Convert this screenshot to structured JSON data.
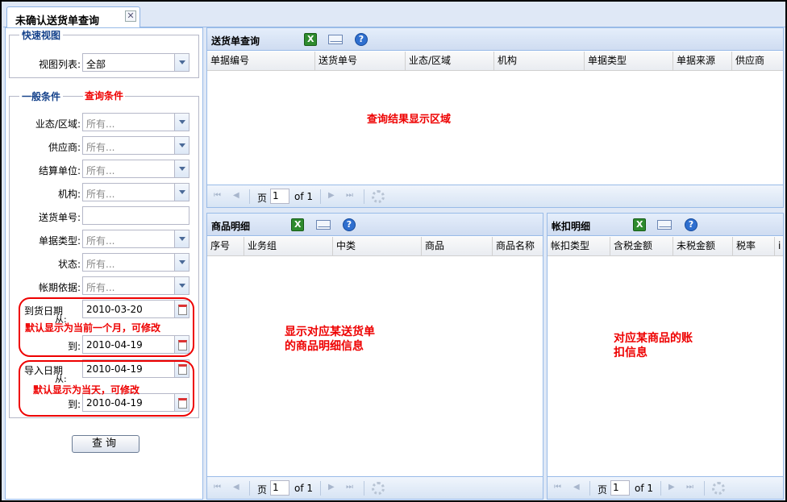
{
  "tab": {
    "title": "未确认送货单查询",
    "close": "✕"
  },
  "quick_view": {
    "legend": "快速视图",
    "label": "视图列表:",
    "value": "全部"
  },
  "general": {
    "legend": "一般条件",
    "annotation": "查询条件",
    "fields": [
      {
        "label": "业态/区域:",
        "value": "所有..."
      },
      {
        "label": "供应商:",
        "value": "所有..."
      },
      {
        "label": "结算单位:",
        "value": "所有..."
      },
      {
        "label": "机构:",
        "value": "所有..."
      },
      {
        "label": "送货单号:",
        "value": ""
      },
      {
        "label": "单据类型:",
        "value": "所有..."
      },
      {
        "label": "状态:",
        "value": "所有..."
      },
      {
        "label": "帐期依据:",
        "value": "所有..."
      }
    ],
    "arrival": {
      "from_label": "到货日期",
      "from_suffix": "从:",
      "from_value": "2010-03-20",
      "to_label": "到:",
      "to_value": "2010-04-19",
      "note": "默认显示为当前一个月，可修改"
    },
    "import": {
      "from_label": "导入日期",
      "from_suffix": "从:",
      "from_value": "2010-04-19",
      "to_label": "到:",
      "to_value": "2010-04-19",
      "note": "默认显示为当天，可修改"
    },
    "query_button": "查询"
  },
  "delivery_panel": {
    "title": "送货单查询",
    "columns": [
      "单据编号",
      "送货单号",
      "业态/区域",
      "机构",
      "单据类型",
      "单据来源",
      "供应商"
    ],
    "placeholder": "查询结果显示区域",
    "pager": {
      "page_label": "页",
      "page": "1",
      "of": "of 1"
    }
  },
  "goods_panel": {
    "title": "商品明细",
    "columns": [
      "序号",
      "业务组",
      "中类",
      "商品",
      "商品名称"
    ],
    "placeholder_line1": "显示对应某送货单",
    "placeholder_line2": "的商品明细信息",
    "pager": {
      "page_label": "页",
      "page": "1",
      "of": "of 1"
    }
  },
  "deduct_panel": {
    "title": "帐扣明细",
    "columns": [
      "帐扣类型",
      "含税金额",
      "未税金额",
      "税率",
      "i"
    ],
    "placeholder_line1": "对应某商品的账",
    "placeholder_line2": "扣信息",
    "pager": {
      "page_label": "页",
      "page": "1",
      "of": "of 1"
    }
  },
  "icons": [
    "excel-export-icon",
    "email-icon",
    "help-icon",
    "calendar-icon",
    "dropdown-arrow-icon",
    "refresh-icon"
  ],
  "colors": {
    "accent": "#15428b",
    "annotation_red": "#e00000",
    "panel_border": "#99bbe8"
  }
}
